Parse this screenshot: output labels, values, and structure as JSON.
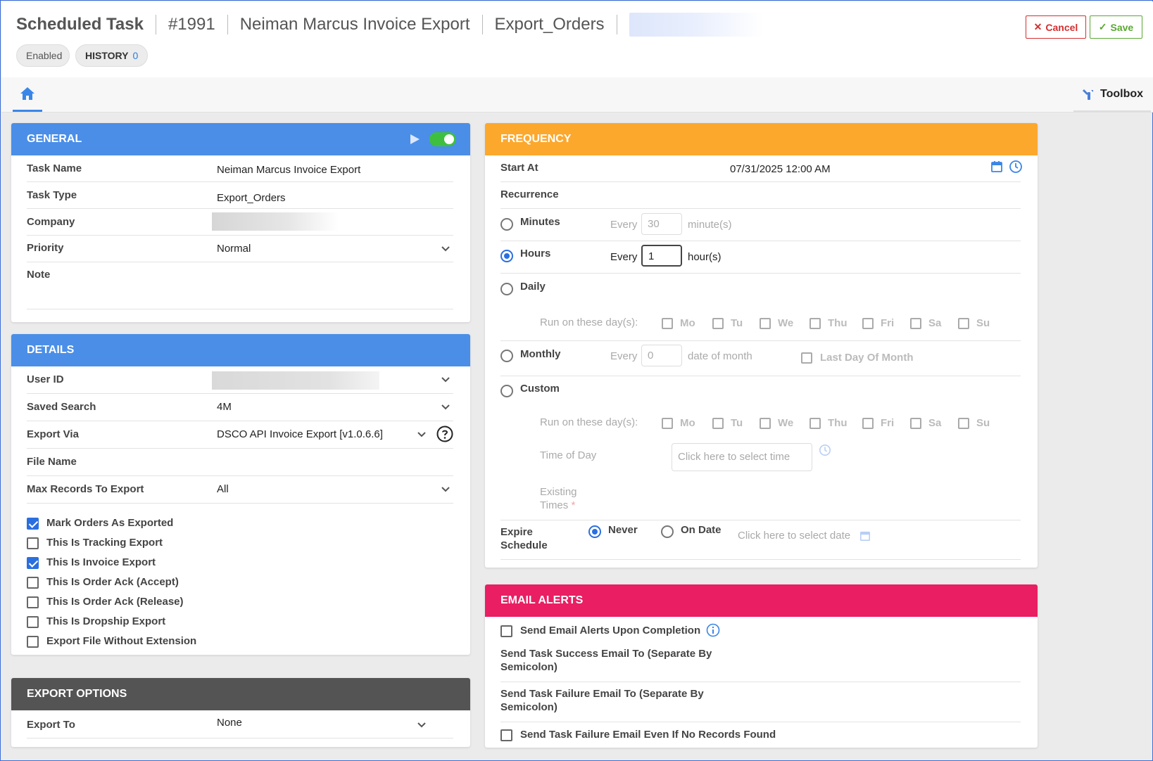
{
  "header": {
    "title": "Scheduled Task",
    "task_number": "#1991",
    "task_name": "Neiman Marcus Invoice Export",
    "task_type": "Export_Orders",
    "status_pill": "Enabled",
    "history_label": "HISTORY",
    "history_count": "0",
    "cancel_label": "Cancel",
    "save_label": "Save"
  },
  "tabs": {
    "toolbox_label": "Toolbox"
  },
  "general": {
    "title": "GENERAL",
    "enabled": true,
    "fields": {
      "task_name_label": "Task Name",
      "task_name_value": "Neiman Marcus Invoice Export",
      "task_type_label": "Task Type",
      "task_type_value": "Export_Orders",
      "company_label": "Company",
      "priority_label": "Priority",
      "priority_value": "Normal",
      "note_label": "Note"
    }
  },
  "details": {
    "title": "DETAILS",
    "user_id_label": "User ID",
    "saved_search_label": "Saved Search",
    "saved_search_value": "4M",
    "export_via_label": "Export Via",
    "export_via_value": "DSCO API Invoice Export [v1.0.6.6]",
    "file_name_label": "File Name",
    "max_records_label": "Max Records To Export",
    "max_records_value": "All",
    "checkboxes": [
      {
        "label": "Mark Orders As Exported",
        "checked": true
      },
      {
        "label": "This Is Tracking Export",
        "checked": false
      },
      {
        "label": "This Is Invoice Export",
        "checked": true
      },
      {
        "label": "This Is Order Ack (Accept)",
        "checked": false
      },
      {
        "label": "This Is Order Ack (Release)",
        "checked": false
      },
      {
        "label": "This Is Dropship Export",
        "checked": false
      },
      {
        "label": "Export File Without Extension",
        "checked": false
      }
    ]
  },
  "export_options": {
    "title": "EXPORT OPTIONS",
    "export_to_label": "Export To",
    "export_to_value": "None"
  },
  "frequency": {
    "title": "FREQUENCY",
    "start_at_label": "Start At",
    "start_at_value": "07/31/2025 12:00 AM",
    "recurrence_label": "Recurrence",
    "selected": "Hours",
    "minutes_label": "Minutes",
    "every_label": "Every",
    "minutes_value": "30",
    "minutes_unit": "minute(s)",
    "hours_label": "Hours",
    "hours_value": "1",
    "hours_unit": "hour(s)",
    "daily_label": "Daily",
    "run_days_label": "Run on these day(s):",
    "days": [
      "Mo",
      "Tu",
      "We",
      "Thu",
      "Fri",
      "Sa",
      "Su"
    ],
    "monthly_label": "Monthly",
    "monthly_value": "0",
    "monthly_unit": "date of month",
    "last_day_label": "Last Day Of Month",
    "custom_label": "Custom",
    "time_of_day_label": "Time of Day",
    "time_placeholder": "Click here to select time",
    "existing_times_label": "Existing",
    "existing_times_label2": "Times",
    "required_mark": "*",
    "expire_label": "Expire",
    "expire_label2": "Schedule",
    "never_label": "Never",
    "on_date_label": "On Date",
    "date_placeholder": "Click here to select date"
  },
  "email_alerts": {
    "title": "EMAIL ALERTS",
    "send_alerts_label": "Send Email Alerts Upon Completion",
    "success_label_1": "Send Task Success Email To (Separate By",
    "success_label_2": "Semicolon)",
    "failure_label_1": "Send Task Failure Email To (Separate By",
    "failure_label_2": "Semicolon)",
    "failure_no_records_label": "Send Task Failure Email Even If No Records Found"
  },
  "colors": {
    "blue_header": "#4a8ee8",
    "orange_header": "#fca82d",
    "pink_header": "#e91e63",
    "dark_header": "#545454",
    "toggle_on": "#3fbf3f",
    "cancel": "#d32f2f",
    "save": "#5aa832"
  }
}
